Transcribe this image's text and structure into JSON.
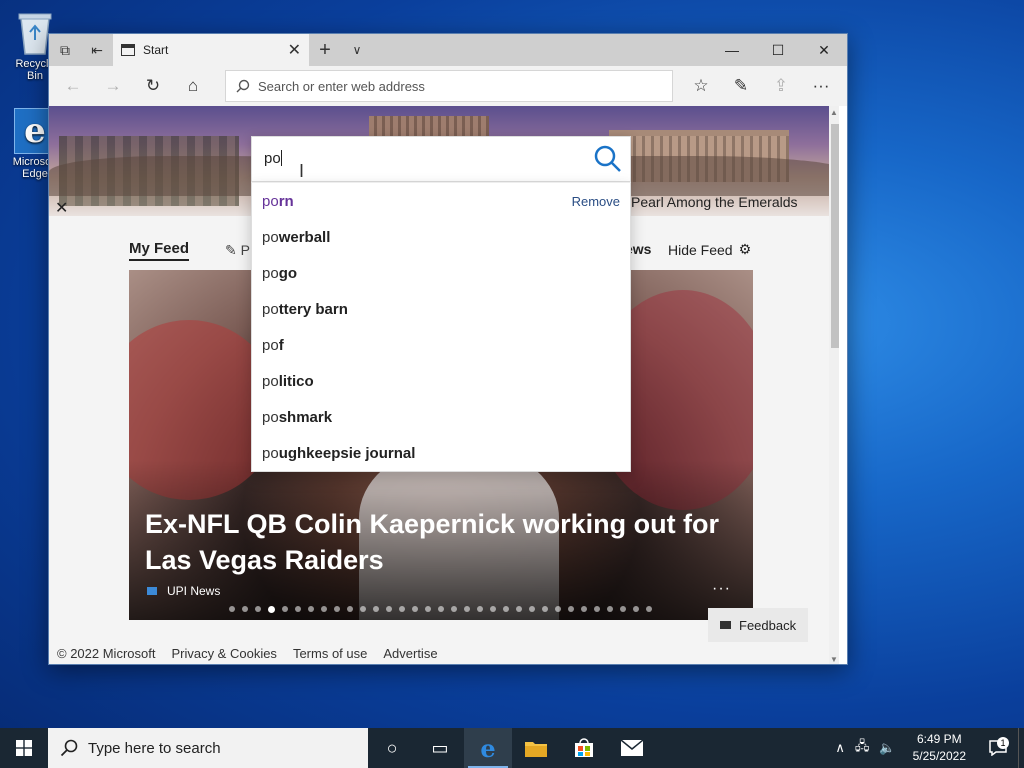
{
  "desktop": {
    "icons": [
      {
        "label": "Recycle Bin",
        "icon": "recycle-bin-icon"
      },
      {
        "label": "Microsoft Edge",
        "icon": "edge-icon"
      }
    ]
  },
  "browser": {
    "tab_title": "Start",
    "address_placeholder": "Search or enter web address",
    "hero_caption": "Pearl Among the Emeralds",
    "feed": {
      "my_feed": "My Feed",
      "partial_tab": "P",
      "partial_news": "ews",
      "hide_feed": "Hide Feed"
    },
    "card": {
      "headline": "Ex-NFL QB Colin Kaepernick working out for Las Vegas Raiders",
      "source": "UPI News",
      "more": "···",
      "pager_count": 33,
      "pager_active_index": 3
    },
    "feedback": "Feedback",
    "footer": [
      "© 2022 Microsoft",
      "Privacy & Cookies",
      "Terms of use",
      "Advertise"
    ],
    "search": {
      "query": "po",
      "remove_label": "Remove",
      "suggestions": [
        {
          "prefix": "po",
          "rest": "rn",
          "visited": true
        },
        {
          "prefix": "po",
          "rest": "werball",
          "visited": false
        },
        {
          "prefix": "po",
          "rest": "go",
          "visited": false
        },
        {
          "prefix": "po",
          "rest": "ttery barn",
          "visited": false
        },
        {
          "prefix": "po",
          "rest": "f",
          "visited": false
        },
        {
          "prefix": "po",
          "rest": "litico",
          "visited": false
        },
        {
          "prefix": "po",
          "rest": "shmark",
          "visited": false
        },
        {
          "prefix": "po",
          "rest": "ughkeepsie journal",
          "visited": false
        }
      ]
    }
  },
  "taskbar": {
    "search_placeholder": "Type here to search",
    "time": "6:49 PM",
    "date": "5/25/2022",
    "notification_count": "1"
  },
  "colors": {
    "accent": "#0078d7",
    "visited_link": "#663399",
    "taskbar": "#1a2733"
  }
}
